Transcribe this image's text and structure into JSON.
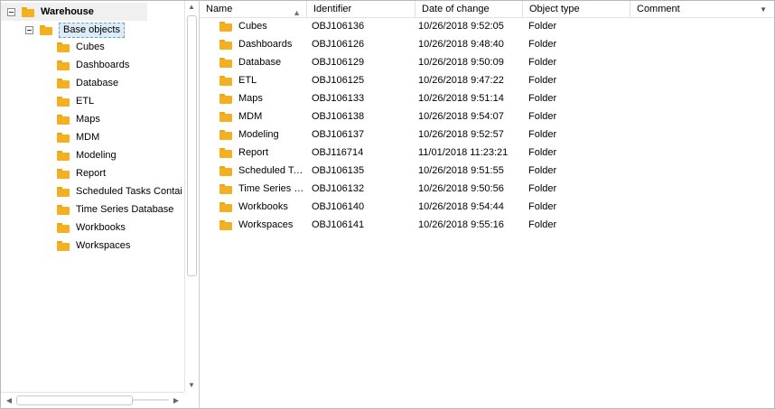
{
  "tree": {
    "root": {
      "label": "Warehouse"
    },
    "selected": {
      "label": "Base objects"
    },
    "children": [
      "Cubes",
      "Dashboards",
      "Database",
      "ETL",
      "Maps",
      "MDM",
      "Modeling",
      "Report",
      "Scheduled Tasks Contai",
      "Time Series Database",
      "Workbooks",
      "Workspaces"
    ],
    "icons": {
      "expander": "collapse-icon",
      "folder": "folder-icon"
    }
  },
  "list": {
    "columns": [
      "Name",
      "Identifier",
      "Date of change",
      "Object type",
      "Comment"
    ],
    "rows": [
      {
        "name": "Cubes",
        "id": "OBJ106136",
        "date": "10/26/2018 9:52:05",
        "type": "Folder"
      },
      {
        "name": "Dashboards",
        "id": "OBJ106126",
        "date": "10/26/2018 9:48:40",
        "type": "Folder"
      },
      {
        "name": "Database",
        "id": "OBJ106129",
        "date": "10/26/2018 9:50:09",
        "type": "Folder"
      },
      {
        "name": "ETL",
        "id": "OBJ106125",
        "date": "10/26/2018 9:47:22",
        "type": "Folder"
      },
      {
        "name": "Maps",
        "id": "OBJ106133",
        "date": "10/26/2018 9:51:14",
        "type": "Folder"
      },
      {
        "name": "MDM",
        "id": "OBJ106138",
        "date": "10/26/2018 9:54:07",
        "type": "Folder"
      },
      {
        "name": "Modeling",
        "id": "OBJ106137",
        "date": "10/26/2018 9:52:57",
        "type": "Folder"
      },
      {
        "name": "Report",
        "id": "OBJ116714",
        "date": "11/01/2018 11:23:21",
        "type": "Folder"
      },
      {
        "name": "Scheduled Ta…",
        "id": "OBJ106135",
        "date": "10/26/2018 9:51:55",
        "type": "Folder"
      },
      {
        "name": "Time Series …",
        "id": "OBJ106132",
        "date": "10/26/2018 9:50:56",
        "type": "Folder"
      },
      {
        "name": "Workbooks",
        "id": "OBJ106140",
        "date": "10/26/2018 9:54:44",
        "type": "Folder"
      },
      {
        "name": "Workspaces",
        "id": "OBJ106141",
        "date": "10/26/2018 9:55:16",
        "type": "Folder"
      }
    ]
  },
  "colors": {
    "folder": "#f5b022",
    "selection": "#dcebf8",
    "selection_border": "#6c9fd1"
  }
}
